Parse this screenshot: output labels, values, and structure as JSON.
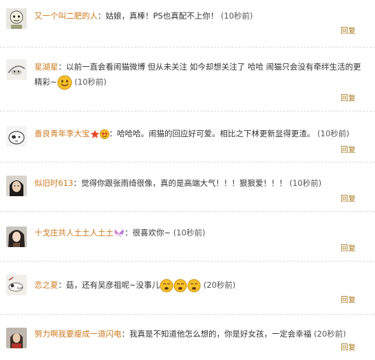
{
  "comments": [
    {
      "user": "又一个叫二肥的人",
      "text": "：姑娘，真棒！PS也真配不上你！",
      "time": "(10秒前)",
      "reply": "回复"
    },
    {
      "user": "星湖星",
      "text": "：以前一直会看闹猫微博 但从未关注 如今却想关注了 哈哈 闹猫只会没有牵绊生活的更精彩~",
      "time": "(10秒前)",
      "reply": "回复"
    },
    {
      "user": "善良青年李大宝",
      "text": "：哈哈哈。闹猫的回应好可爱。相比之下林更新显得更渣。",
      "time": "(10秒前)",
      "reply": "回复"
    },
    {
      "user": "似旧时613",
      "text": "：觉得你跟张雨绮很像，真的是高端大气！！！狠狠爱！！！",
      "time": "(10秒前)",
      "reply": "回复"
    },
    {
      "user": "十戈庄共人土土人土土",
      "text": "：很喜欢你~",
      "time": "(10秒前)",
      "reply": "回复"
    },
    {
      "user": "恋之夏",
      "text": "：菇，还有吴彦祖呢~没事儿",
      "time": "(20秒前)",
      "reply": "回复"
    },
    {
      "user": "努力啊我要瘦成一道闪电",
      "text": "：我真是不知道他怎么想的，你是好女孩，一定会幸福",
      "time": "(20秒前)",
      "reply": "回复"
    }
  ],
  "colors": {
    "username": "#cc7a1f",
    "reply": "#a8781e",
    "text": "#333333"
  }
}
